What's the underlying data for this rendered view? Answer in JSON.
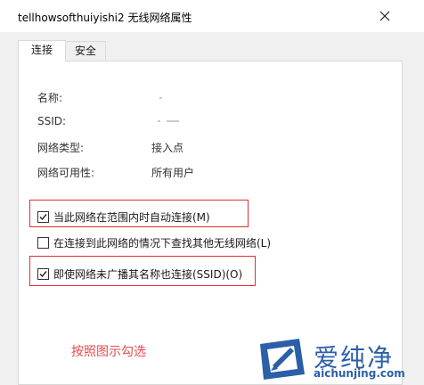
{
  "window": {
    "title": "tellhowsofthuiyishi2 无线网络属性"
  },
  "tabs": [
    {
      "label": "连接",
      "active": true
    },
    {
      "label": "安全",
      "active": false
    }
  ],
  "info_rows": [
    {
      "label": "名称:",
      "value": ""
    },
    {
      "label": "SSID:",
      "value": ""
    },
    {
      "label": "网络类型:",
      "value": "接入点"
    },
    {
      "label": "网络可用性:",
      "value": "所有用户"
    }
  ],
  "options": [
    {
      "label": "当此网络在范围内时自动连接(M)",
      "checked": true,
      "highlighted": true
    },
    {
      "label": "在连接到此网络的情况下查找其他无线网络(L)",
      "checked": false,
      "highlighted": false
    },
    {
      "label": "即使网络未广播其名称也连接(SSID)(O)",
      "checked": true,
      "highlighted": true
    }
  ],
  "annotation": {
    "note": "按照图示勾选",
    "color": "#e84a4a"
  },
  "watermark": {
    "brand": "爱纯净",
    "url": "aichunjing.com",
    "color": "#2b5fa8"
  }
}
